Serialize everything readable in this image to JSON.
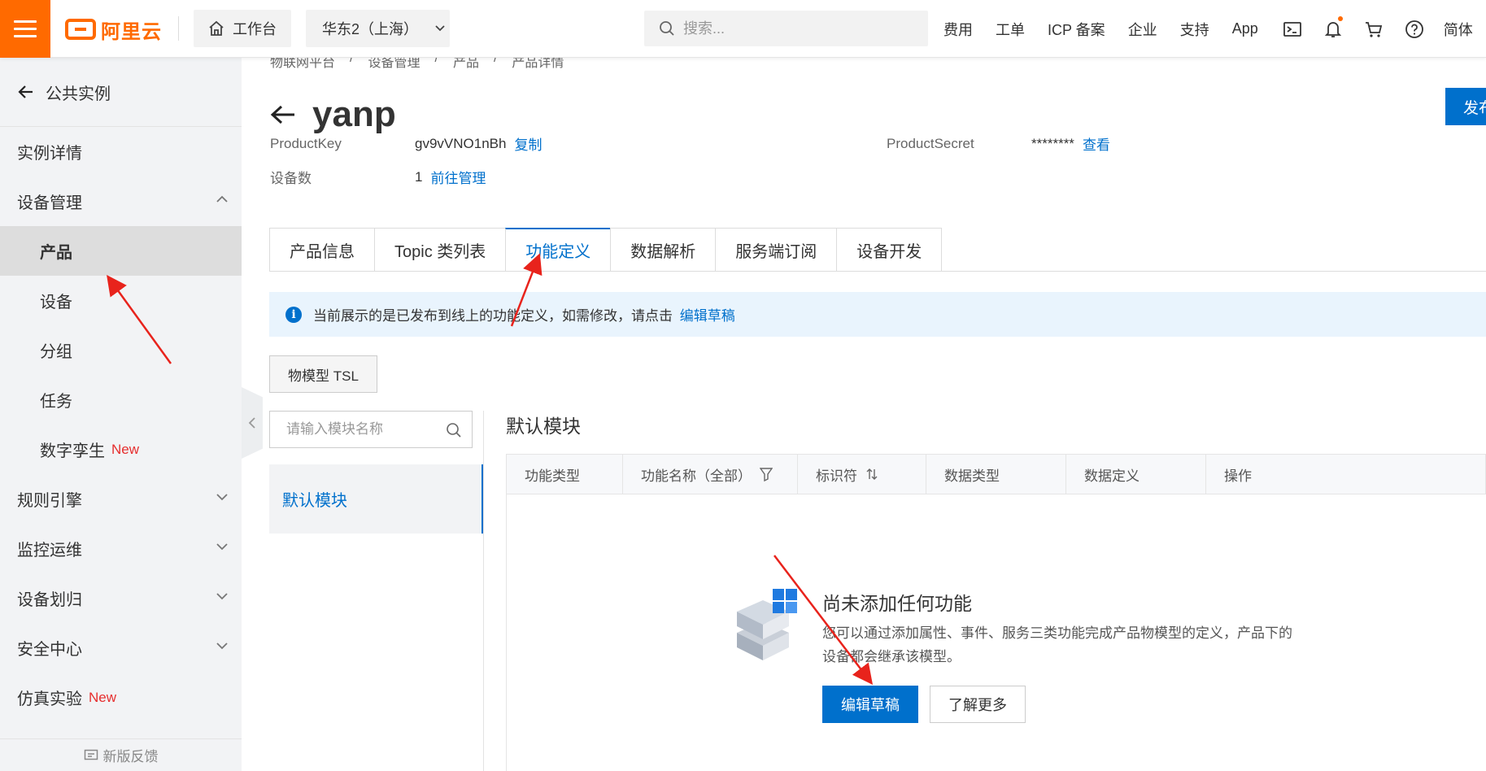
{
  "topbar": {
    "logo_text": "阿里云",
    "workbench_label": "工作台",
    "region_label": "华东2（上海）",
    "search_placeholder": "搜索...",
    "nav": [
      "费用",
      "工单",
      "ICP 备案",
      "企业",
      "支持",
      "App"
    ],
    "language_label": "简体",
    "brand_color": "#ff6a00"
  },
  "sidebar": {
    "back_label": "公共实例",
    "items": [
      {
        "label": "实例详情"
      },
      {
        "label": "设备管理"
      },
      {
        "label": "产品"
      },
      {
        "label": "设备"
      },
      {
        "label": "分组"
      },
      {
        "label": "任务"
      },
      {
        "label": "数字孪生",
        "tag": "New"
      },
      {
        "label": "规则引擎"
      },
      {
        "label": "监控运维"
      },
      {
        "label": "设备划归"
      },
      {
        "label": "安全中心"
      },
      {
        "label": "仿真实验",
        "tag": "New"
      }
    ],
    "feedback_label": "新版反馈"
  },
  "main": {
    "breadcrumb": [
      "物联网平台",
      "/",
      "设备管理",
      "/",
      "产品",
      "/",
      "产品详情"
    ],
    "title": "yanp",
    "publish_label": "发布",
    "product_key_label": "ProductKey",
    "product_key_value": "gv9vVNO1nBh",
    "copy_label": "复制",
    "product_secret_label": "ProductSecret",
    "product_secret_value": "********",
    "view_label": "查看",
    "device_count_label": "设备数",
    "device_count_value": "1",
    "manage_label": "前往管理",
    "tabs": [
      "产品信息",
      "Topic 类列表",
      "功能定义",
      "数据解析",
      "服务端订阅",
      "设备开发"
    ],
    "notice_text": "当前展示的是已发布到线上的功能定义，如需修改，请点击",
    "notice_link": "编辑草稿",
    "tsl_label": "物模型 TSL",
    "module_search_placeholder": "请输入模块名称",
    "module_item": "默认模块",
    "module_title": "默认模块",
    "table_headers": [
      "功能类型",
      "功能名称（全部）",
      "标识符",
      "数据类型",
      "数据定义",
      "操作"
    ],
    "empty_title": "尚未添加任何功能",
    "empty_desc": "您可以通过添加属性、事件、服务三类功能完成产品物模型的定义，产品下的设备都会继承该模型。",
    "edit_draft_label": "编辑草稿",
    "learn_more_label": "了解更多",
    "accent_color": "#0070cc"
  }
}
